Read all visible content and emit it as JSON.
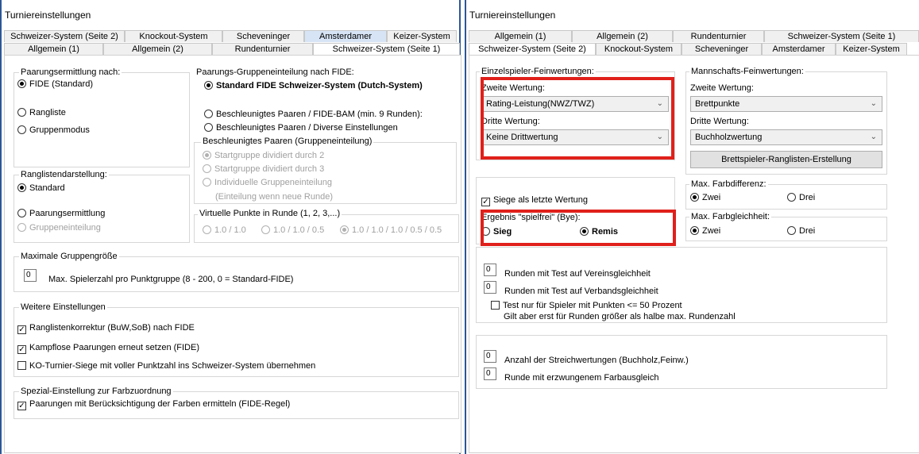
{
  "left": {
    "title": "Turniereinstellungen",
    "tabs_row1": [
      "Schweizer-System (Seite 2)",
      "Knockout-System",
      "Scheveninger",
      "Amsterdamer",
      "Keizer-System"
    ],
    "tabs_row2": [
      "Allgemein (1)",
      "Allgemein (2)",
      "Rundenturnier",
      "Schweizer-System (Seite 1)"
    ],
    "pairing_method": {
      "title": "Paarungsermittlung nach:",
      "opt1": "FIDE (Standard)",
      "opt2": "Rangliste",
      "opt3": "Gruppenmodus"
    },
    "fide_grouping": {
      "title": "Paarungs-Gruppeneinteilung nach FIDE:",
      "opt1": "Standard FIDE Schweizer-System (Dutch-System)",
      "opt2": "Beschleunigtes Paaren / FIDE-BAM (min. 9 Runden):",
      "opt3": "Beschleunigtes Paaren / Diverse Einstellungen"
    },
    "accel": {
      "title": "Beschleunigtes Paaren (Gruppeneinteilung)",
      "opt1": "Startgruppe dividiert durch 2",
      "opt2": "Startgruppe dividiert durch 3",
      "opt3": "Individuelle Gruppeneinteilung",
      "note": "(Einteilung wenn neue Runde)"
    },
    "ranking_display": {
      "title": "Ranglistendarstellung:",
      "opt1": "Standard",
      "opt2": "Paarungsermittlung",
      "opt3": "Gruppeneinteilung"
    },
    "virtual_points": {
      "title": "Virtuelle Punkte in Runde (1, 2, 3,...)",
      "opt1": "1.0 / 1.0",
      "opt2": "1.0 / 1.0 / 0.5",
      "opt3": "1.0 / 1.0 / 1.0 / 0.5 / 0.5"
    },
    "max_group": {
      "title": "Maximale Gruppengröße",
      "value": "0",
      "label": "Max. Spielerzahl pro Punktgruppe (8 - 200, 0 = Standard-FIDE)"
    },
    "more": {
      "title": "Weitere Einstellungen",
      "c1": "Ranglistenkorrektur (BuW,SoB) nach FIDE",
      "c2": "Kampflose Paarungen erneut setzen (FIDE)",
      "c3": "KO-Turnier-Siege mit voller Punktzahl ins Schweizer-System übernehmen"
    },
    "color": {
      "title": "Spezial-Einstellung zur Farbzuordnung",
      "c1": "Paarungen mit Berücksichtigung der Farben ermitteln (FIDE-Regel)"
    }
  },
  "right": {
    "title": "Turniereinstellungen",
    "tabs_row1": [
      "Allgemein (1)",
      "Allgemein (2)",
      "Rundenturnier",
      "Schweizer-System (Seite 1)"
    ],
    "tabs_row2": [
      "Schweizer-System (Seite 2)",
      "Knockout-System",
      "Scheveninger",
      "Amsterdamer",
      "Keizer-System"
    ],
    "single_fine": {
      "title": "Einzelspieler-Feinwertungen:",
      "second_label": "Zweite Wertung:",
      "second_value": "Rating-Leistung(NWZ/TWZ)",
      "third_label": "Dritte Wertung:",
      "third_value": "Keine Drittwertung"
    },
    "team_fine": {
      "title": "Mannschafts-Feinwertungen:",
      "second_label": "Zweite Wertung:",
      "second_value": "Brettpunkte",
      "third_label": "Dritte Wertung:",
      "third_value": "Buchholzwertung",
      "button": "Brettspieler-Ranglisten-Erstellung"
    },
    "wins_last": "Siege als letzte Wertung",
    "bye": {
      "title": "Ergebnis \"spielfrei\" (Bye):",
      "opt1": "Sieg",
      "opt2": "Remis"
    },
    "max_color_diff": {
      "title": "Max. Farbdifferenz:",
      "opt1": "Zwei",
      "opt2": "Drei"
    },
    "max_color_same": {
      "title": "Max. Farbgleichheit:",
      "opt1": "Zwei",
      "opt2": "Drei"
    },
    "rounds": {
      "v1": "0",
      "l1": "Runden mit Test auf Vereinsgleichheit",
      "v2": "0",
      "l2": "Runden mit Test auf Verbandsgleichheit",
      "c1": "Test nur für Spieler mit Punkten <= 50 Prozent",
      "note": "Gilt aber erst für Runden größer als halbe max. Rundenzahl"
    },
    "strike": {
      "v1": "0",
      "l1": "Anzahl der Streichwertungen (Buchholz,Feinw.)",
      "v2": "0",
      "l2": "Runde mit erzwungenem Farbausgleich"
    }
  },
  "colors": {
    "accent_border": "#2b5797",
    "highlight": "#e0201b",
    "tab_hover": "#d6e4f5"
  }
}
